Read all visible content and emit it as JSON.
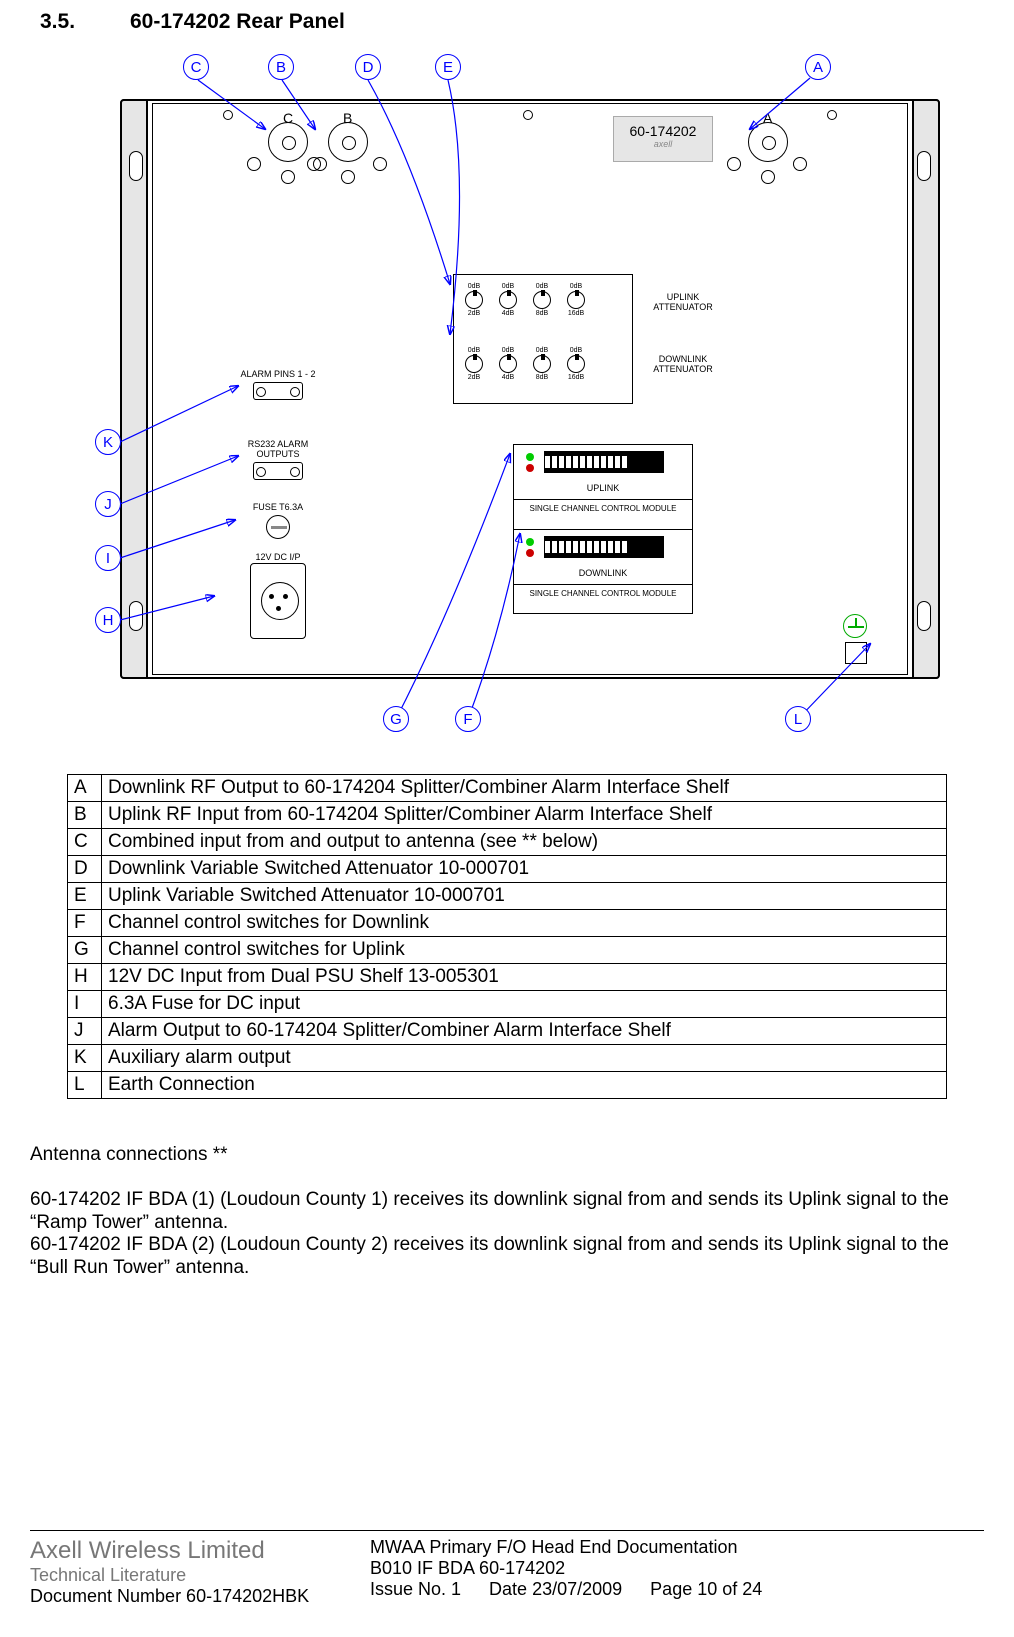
{
  "section": {
    "number": "3.5.",
    "title": "60-174202 Rear Panel"
  },
  "panel": {
    "model": "60-174202",
    "logo": "axell",
    "connectors": {
      "A": "A",
      "B": "B",
      "C": "C"
    },
    "attenuator": {
      "uplink_label": "UPLINK ATTENUATOR",
      "downlink_label": "DOWNLINK ATTENUATOR",
      "switches": [
        {
          "top": "0dB",
          "bottom": "2dB"
        },
        {
          "top": "0dB",
          "bottom": "4dB"
        },
        {
          "top": "0dB",
          "bottom": "8dB"
        },
        {
          "top": "0dB",
          "bottom": "16dB"
        }
      ]
    },
    "control_module": {
      "uplink": "UPLINK",
      "downlink": "DOWNLINK",
      "name": "SINGLE CHANNEL CONTROL MODULE"
    },
    "left_stack": {
      "alarm": "ALARM PINS 1 - 2",
      "rs232": "RS232 ALARM OUTPUTS",
      "fuse": "FUSE T6.3A",
      "dc": "12V DC I/P"
    }
  },
  "callouts": [
    "A",
    "B",
    "C",
    "D",
    "E",
    "F",
    "G",
    "H",
    "I",
    "J",
    "K",
    "L"
  ],
  "legend": [
    {
      "k": "A",
      "v": "Downlink RF Output to 60-174204 Splitter/Combiner Alarm Interface Shelf"
    },
    {
      "k": "B",
      "v": "Uplink RF Input from 60-174204 Splitter/Combiner Alarm Interface Shelf"
    },
    {
      "k": "C",
      "v": "Combined input from and output to antenna (see ** below)"
    },
    {
      "k": "D",
      "v": "Downlink Variable Switched Attenuator 10-000701"
    },
    {
      "k": "E",
      "v": "Uplink Variable Switched Attenuator 10-000701"
    },
    {
      "k": "F",
      "v": "Channel control switches for Downlink"
    },
    {
      "k": "G",
      "v": "Channel control switches for Uplink"
    },
    {
      "k": "H",
      "v": "12V DC Input from Dual PSU Shelf 13-005301"
    },
    {
      "k": "I",
      "v": "6.3A Fuse for DC input"
    },
    {
      "k": "J",
      "v": "Alarm Output to 60-174204 Splitter/Combiner Alarm Interface Shelf"
    },
    {
      "k": "K",
      "v": "Auxiliary alarm output"
    },
    {
      "k": "L",
      "v": "Earth Connection"
    }
  ],
  "notes": {
    "heading": "Antenna connections **",
    "p1": "60-174202 IF BDA (1) (Loudoun County 1) receives its downlink signal from and sends its Uplink signal to the “Ramp Tower” antenna.",
    "p2": "60-174202 IF BDA (2) (Loudoun County 2) receives its downlink signal from and sends its Uplink signal to the “Bull Run Tower” antenna."
  },
  "footer": {
    "company": "Axell Wireless Limited",
    "dept": "Technical Literature",
    "docnum_label": "Document Number 60-174202HBK",
    "title1": "MWAA Primary F/O Head End Documentation",
    "title2": "B010 IF BDA 60-174202",
    "issue": "Issue No. 1",
    "date": "Date 23/07/2009",
    "page": "Page 10 of 24"
  }
}
